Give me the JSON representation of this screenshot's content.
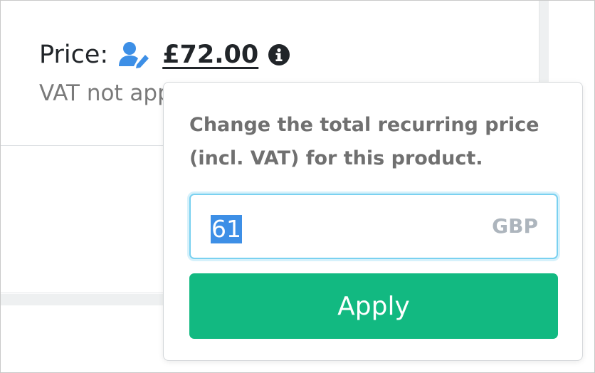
{
  "price_row": {
    "label": "Price:",
    "amount": "£72.00",
    "edit_icon": "user-edit-icon",
    "info_icon": "info-circle-icon"
  },
  "vat_note": "VAT not app",
  "popover": {
    "description": "Change the total recurring price (incl. VAT) for this product.",
    "input_value": "61",
    "currency_suffix": "GBP",
    "apply_label": "Apply"
  },
  "colors": {
    "accent_blue": "#3d8fe6",
    "apply_green": "#12b981",
    "focus_ring": "#7ad1f0"
  }
}
